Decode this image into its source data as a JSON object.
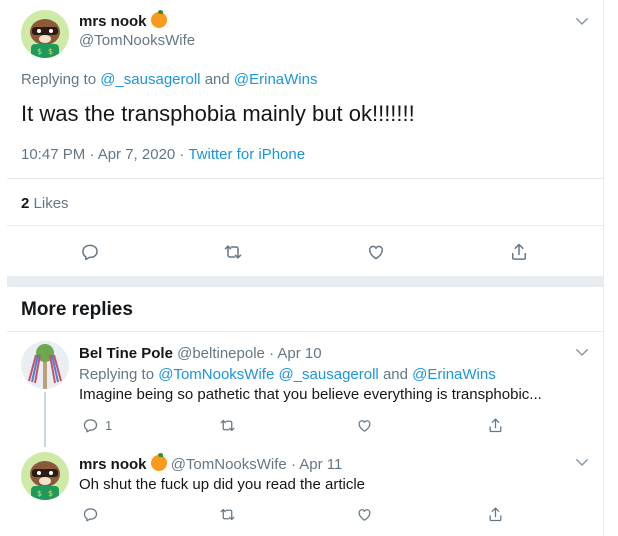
{
  "main_tweet": {
    "name": "mrs nook",
    "handle": "@TomNooksWife",
    "replying_prefix": "Replying to",
    "replying_user1": "@_sausageroll",
    "replying_and": "and",
    "replying_user2": "@ErinaWins",
    "text": "It was the transphobia mainly but ok!!!!!!!",
    "time": "10:47 PM · Apr 7, 2020 ·",
    "source": "Twitter for iPhone",
    "likes_count": "2",
    "likes_label": "Likes"
  },
  "more_replies": {
    "title": "More replies"
  },
  "replies": [
    {
      "name": "Bel Tine Pole",
      "handle": "@beltinepole",
      "date": "· Apr 10",
      "replying_prefix": "Replying to",
      "replying_user1": "@TomNooksWife",
      "replying_user2": "@_sausageroll",
      "replying_and": "and",
      "replying_user3": "@ErinaWins",
      "text": "Imagine being so pathetic that you believe everything is transphobic...",
      "reply_count": "1"
    },
    {
      "name": "mrs nook",
      "handle": "@TomNooksWife",
      "date": "· Apr 11",
      "text": "Oh shut the fuck up did you read the article"
    }
  ],
  "colors": {
    "link": "#1b95e0",
    "muted": "#657786",
    "separator": "#e6ecf0"
  }
}
